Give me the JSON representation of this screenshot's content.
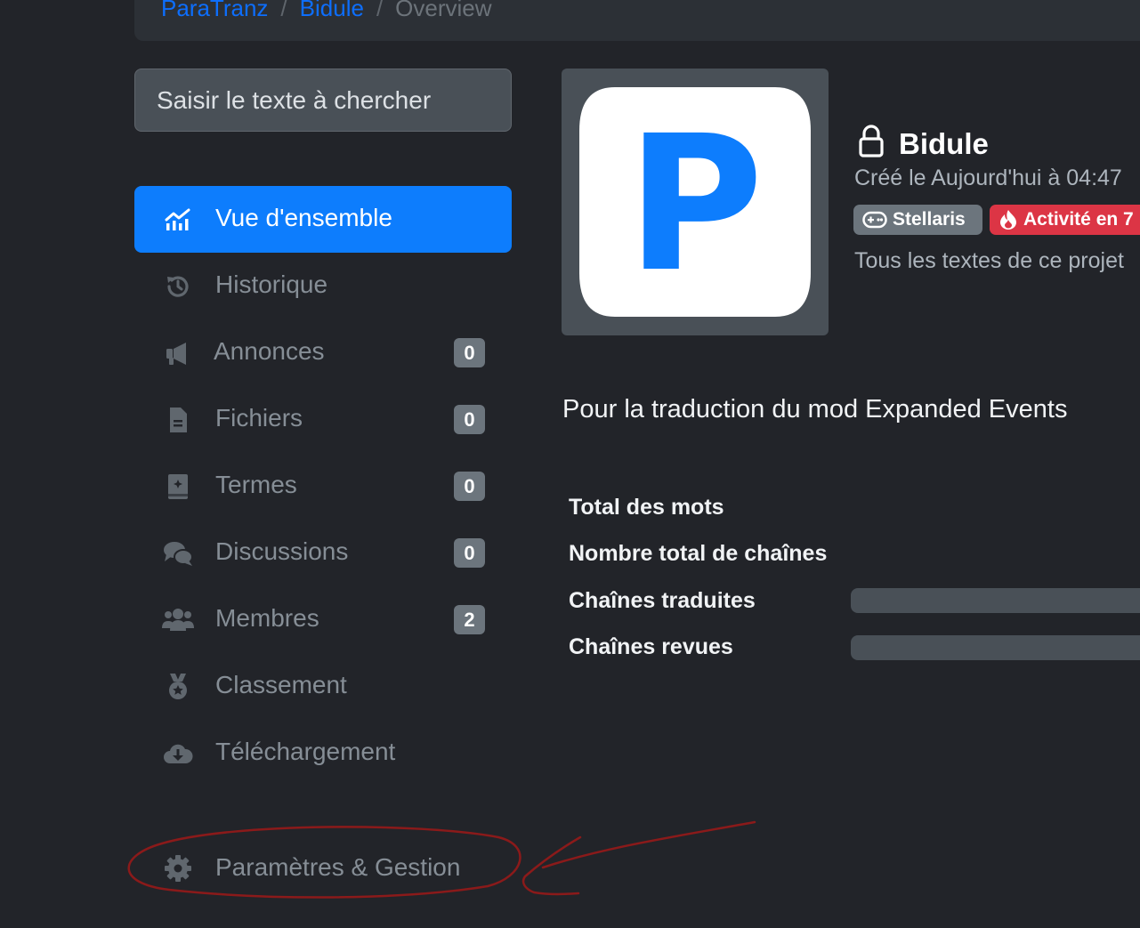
{
  "breadcrumb": {
    "items": [
      "ParaTranz",
      "Bidule"
    ],
    "current": "Overview",
    "separator": "/"
  },
  "search": {
    "placeholder": "Saisir le texte à chercher"
  },
  "nav": {
    "items": [
      {
        "label": "Vue d'ensemble",
        "icon": "chart-line-icon",
        "active": true
      },
      {
        "label": "Historique",
        "icon": "history-icon"
      },
      {
        "label": "Annonces",
        "icon": "megaphone-icon",
        "count": "0"
      },
      {
        "label": "Fichiers",
        "icon": "file-icon",
        "count": "0"
      },
      {
        "label": "Termes",
        "icon": "book-icon",
        "count": "0"
      },
      {
        "label": "Discussions",
        "icon": "comments-icon",
        "count": "0"
      },
      {
        "label": "Membres",
        "icon": "users-icon",
        "count": "2"
      },
      {
        "label": "Classement",
        "icon": "medal-icon"
      },
      {
        "label": "Téléchargement",
        "icon": "cloud-download-icon"
      }
    ],
    "settings": {
      "label": "Paramètres & Gestion",
      "icon": "gear-icon"
    }
  },
  "project": {
    "logo_letter": "P",
    "name": "Bidule",
    "lock_icon": "lock-icon",
    "created": "Créé le Aujourd'hui à 04:47",
    "game_tag": "Stellaris",
    "activity_tag": "Activité en 7",
    "visibility_note": "Tous les textes de ce projet",
    "description": "Pour la traduction du mod Expanded Events"
  },
  "stats": {
    "total_words_label": "Total des mots",
    "total_strings_label": "Nombre total de chaînes",
    "translated_label": "Chaînes traduites",
    "translated_progress": 0,
    "reviewed_label": "Chaînes revues",
    "reviewed_progress": 0
  },
  "colors": {
    "background": "#222429",
    "accent": "#0d7dfd",
    "badge": "#6c757d",
    "danger": "#dc3545",
    "annotation": "#8b1a1a"
  }
}
